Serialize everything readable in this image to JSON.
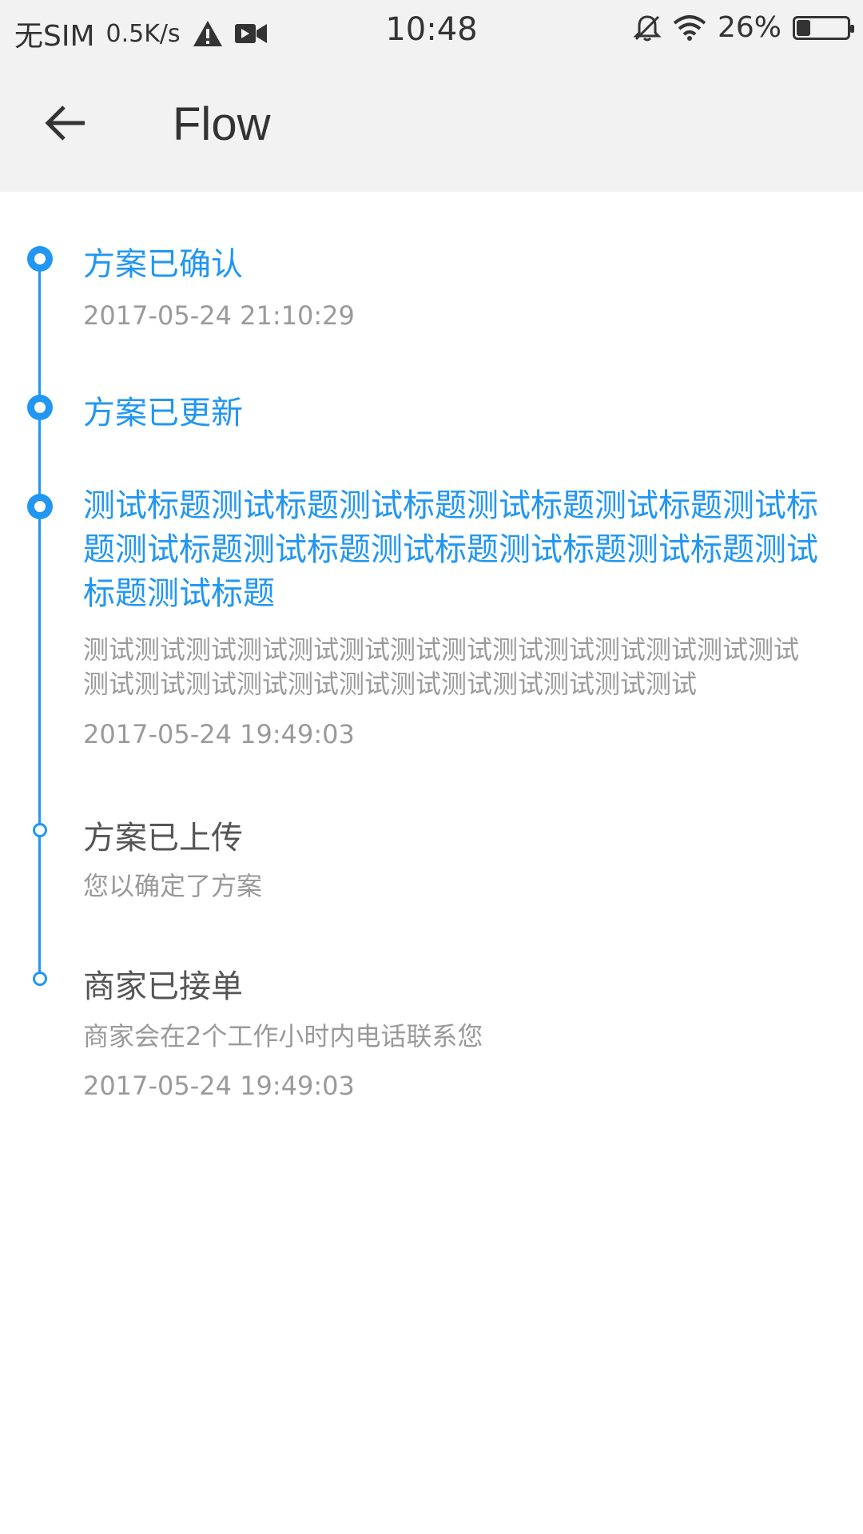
{
  "statusbar": {
    "carrier": "无SIM",
    "speed": "0.5K/s",
    "time": "10:48",
    "battery": "26%"
  },
  "toolbar": {
    "title": "Flow"
  },
  "timeline": [
    {
      "title": "方案已确认",
      "desc": "",
      "time": "2017-05-24 21:10:29"
    },
    {
      "title": "方案已更新",
      "desc": "",
      "time": ""
    },
    {
      "title": "测试标题测试标题测试标题测试标题测试标题测试标题测试标题测试标题测试标题测试标题测试标题测试标题测试标题",
      "desc": "测试测试测试测试测试测试测试测试测试测试测试测试测试测试测试测试测试测试测试测试测试测试测试测试测试测试",
      "time": "2017-05-24 19:49:03"
    },
    {
      "title": "方案已上传",
      "desc": "您以确定了方案",
      "time": ""
    },
    {
      "title": "商家已接单",
      "desc": "商家会在2个工作小时内电话联系您",
      "time": "2017-05-24 19:49:03"
    }
  ],
  "colors": {
    "accent": "#2196f3",
    "toolbar_bg": "#f2f2f2",
    "muted": "#9a9a9a"
  }
}
